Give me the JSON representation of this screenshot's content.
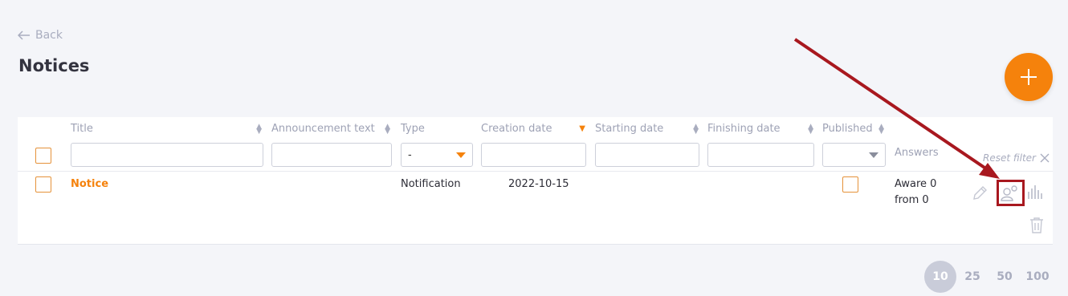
{
  "nav": {
    "back_label": "Back"
  },
  "page": {
    "title": "Notices"
  },
  "table": {
    "headers": {
      "title": "Title",
      "announcement": "Announcement text",
      "type": "Type",
      "creation": "Creation date",
      "starting": "Starting date",
      "finishing": "Finishing date",
      "published": "Published",
      "answers": "Answers"
    },
    "filters": {
      "type_selected": "-",
      "reset_label": "Reset filter"
    },
    "rows": [
      {
        "title": "Notice",
        "type": "Notification",
        "creation_date": "2022-10-15",
        "answers_aware": "Aware 0",
        "answers_from": "from 0"
      }
    ]
  },
  "pagination": {
    "options": [
      "10",
      "25",
      "50",
      "100"
    ],
    "selected": "10"
  },
  "colors": {
    "accent": "#f5820c",
    "highlight": "#a8181f",
    "background": "#f4f5f9"
  },
  "icons": [
    "arrow-left-icon",
    "plus-icon",
    "sort-icon",
    "pencil-icon",
    "users-icon",
    "stats-icon",
    "trash-icon",
    "close-icon",
    "chevron-down-icon"
  ]
}
